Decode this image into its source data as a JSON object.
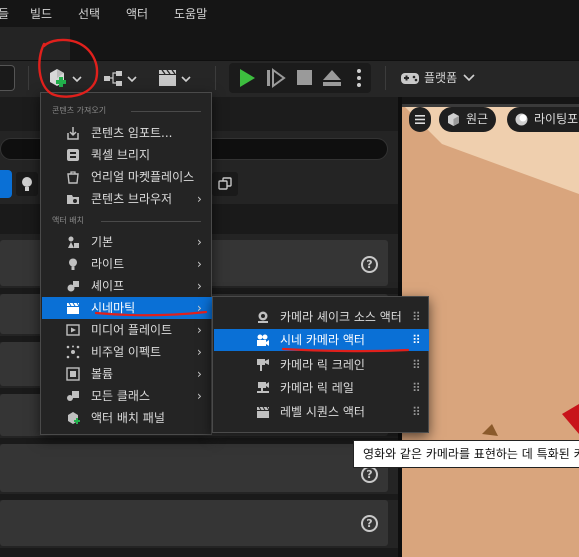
{
  "menubar": {
    "items": [
      "들",
      "빌드",
      "선택",
      "액터",
      "도움말"
    ]
  },
  "toolbar": {
    "add_icon": "cube-plus-icon",
    "blueprint_icon": "blueprint-icon",
    "cinematics_icon": "clapperboard-icon",
    "play_icon": "play-icon",
    "advance_icon": "step-icon",
    "stop_icon": "stop-icon",
    "eject_icon": "eject-icon",
    "platform_label": "플랫폼"
  },
  "main_menu": {
    "section_content": "콘텐츠 가져오기",
    "section_actor": "액터 배치",
    "items": [
      {
        "label": "콘텐츠 임포트...",
        "icon": "import-icon",
        "submenu": false
      },
      {
        "label": "퀵셀 브리지",
        "icon": "bridge-icon",
        "submenu": false
      },
      {
        "label": "언리얼 마켓플레이스",
        "icon": "marketplace-icon",
        "submenu": false
      },
      {
        "label": "콘텐츠 브라우저",
        "icon": "content-browser-icon",
        "submenu": true
      },
      {
        "label": "기본",
        "icon": "basic-actor-icon",
        "submenu": true
      },
      {
        "label": "라이트",
        "icon": "light-icon",
        "submenu": true
      },
      {
        "label": "셰이프",
        "icon": "shape-icon",
        "submenu": true
      },
      {
        "label": "시네마틱",
        "icon": "cinematic-icon",
        "submenu": true
      },
      {
        "label": "미디어 플레이트",
        "icon": "media-plate-icon",
        "submenu": true
      },
      {
        "label": "비주얼 이펙트",
        "icon": "visual-effects-icon",
        "submenu": true
      },
      {
        "label": "볼륨",
        "icon": "volume-icon",
        "submenu": true
      },
      {
        "label": "모든 클래스",
        "icon": "all-classes-icon",
        "submenu": true
      },
      {
        "label": "액터 배치 패널",
        "icon": "place-actors-icon",
        "submenu": false
      }
    ]
  },
  "sub_menu": {
    "items": [
      {
        "label": "카메라 셰이크 소스 액터",
        "icon": "camera-shake-icon"
      },
      {
        "label": "시네 카메라 액터",
        "icon": "cine-camera-icon"
      },
      {
        "label": "카메라 릭 크레인",
        "icon": "camera-crane-icon"
      },
      {
        "label": "카메라 릭 레일",
        "icon": "camera-rail-icon"
      },
      {
        "label": "레벨 시퀀스 액터",
        "icon": "level-sequence-icon"
      }
    ]
  },
  "viewport": {
    "perspective_label": "원근",
    "lighting_label": "라이팅포"
  },
  "tooltip": {
    "text": "영화와 같은 카메라를 표현하는 데 특화된 카"
  },
  "colors": {
    "accent": "#0a70d6",
    "annotation": "#e0201c",
    "viewport_ground": "#d9a57d"
  }
}
